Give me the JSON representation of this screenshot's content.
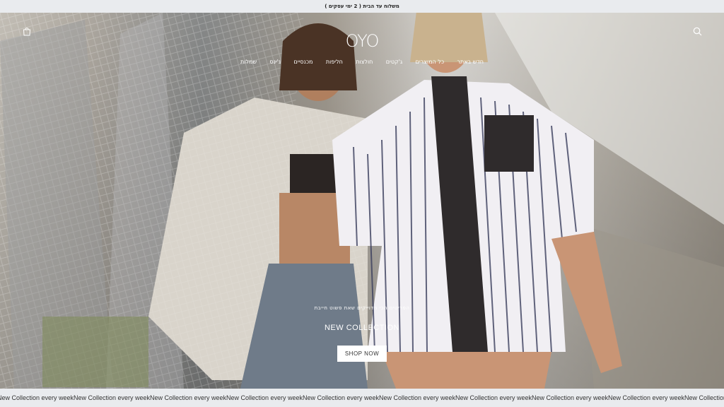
{
  "announcement": "משלוח עד הבית ( 2 ימי עסקים )",
  "header": {
    "logo": "OYO",
    "nav": [
      "חדש באתר",
      "כל המוצרים",
      "ג'קטים",
      "חולצות",
      "חליפות",
      "מכנסיים",
      "ג'ינס",
      "שמלות"
    ]
  },
  "hero": {
    "subtitle": "הפריטים הכי מדוייקים שאת פשוט חייבת",
    "title": "NEW COLLECTION",
    "cta": "SHOP NOW"
  },
  "ticker": {
    "text": "New Collection every week",
    "repeat": 10
  },
  "colors": {
    "bar": "#e9ebee",
    "accent": "#ffffff"
  }
}
